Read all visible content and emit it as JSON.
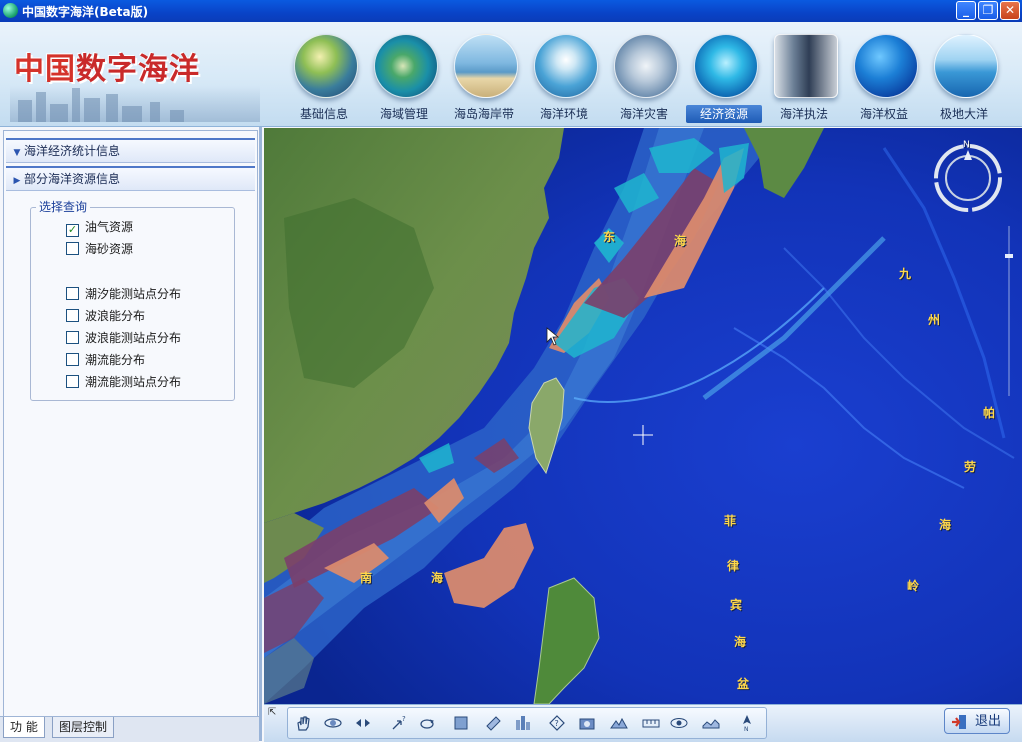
{
  "window": {
    "title": "中国数字海洋(Beta版)",
    "controls": {
      "minimize": "_",
      "restore": "❐",
      "close": "✕"
    }
  },
  "header": {
    "logo_part1": "中国",
    "logo_part2": "数字海洋",
    "nav_tabs": [
      {
        "label": "基础信息",
        "icon": "globe-asia-icon",
        "active": false
      },
      {
        "label": "海域管理",
        "icon": "island-aerial-icon",
        "active": false
      },
      {
        "label": "海岛海岸带",
        "icon": "beach-icon",
        "active": false
      },
      {
        "label": "海洋环境",
        "icon": "seabird-icon",
        "active": false
      },
      {
        "label": "海洋灾害",
        "icon": "storm-wave-icon",
        "active": false
      },
      {
        "label": "经济资源",
        "icon": "dolphins-icon",
        "active": true
      },
      {
        "label": "海洋执法",
        "icon": "officers-icon",
        "active": false
      },
      {
        "label": "海洋权益",
        "icon": "ocean-globe-icon",
        "active": false
      },
      {
        "label": "极地大洋",
        "icon": "polar-sea-icon",
        "active": false
      }
    ]
  },
  "left_panel": {
    "sections": [
      {
        "label": "海洋经济统计信息",
        "expanded": true
      },
      {
        "label": "部分海洋资源信息",
        "expanded": false
      }
    ],
    "query_group": {
      "label": "选择查询",
      "options": [
        {
          "label": "油气资源",
          "checked": true
        },
        {
          "label": "海砂资源",
          "checked": false
        },
        {
          "label": "潮汐能测站点分布",
          "checked": false
        },
        {
          "label": "波浪能分布",
          "checked": false
        },
        {
          "label": "波浪能测站点分布",
          "checked": false
        },
        {
          "label": "潮流能分布",
          "checked": false
        },
        {
          "label": "潮流能测站点分布",
          "checked": false
        }
      ]
    },
    "bottom_tabs": [
      {
        "label": "功 能",
        "active": true
      },
      {
        "label": "图层控制",
        "active": false
      }
    ]
  },
  "map": {
    "labels": {
      "east_sea_1": "东",
      "east_sea_2": "海",
      "south_sea_1": "南",
      "south_sea_2": "海",
      "kyushu": [
        "九",
        "州"
      ],
      "palau": [
        "帕",
        "劳",
        "海",
        "岭"
      ],
      "philippine": [
        "菲",
        "律",
        "宾",
        "海",
        "盆"
      ]
    },
    "compass_label": "N"
  },
  "toolbar": {
    "tools": [
      "pan-hand-icon",
      "orbit-icon",
      "rotate-arrows-icon",
      "zoom-query-icon",
      "rotate-view-icon",
      "layer-map-icon",
      "ruler-icon",
      "buildings-icon",
      "info-query-icon",
      "camera-icon",
      "terrain-icon",
      "scale-bar-icon",
      "view-eye-icon",
      "profile-icon",
      "north-arrow-icon"
    ],
    "exit_label": "退出"
  },
  "colors": {
    "accent": "#1e5bb5",
    "title_bar": "#0a4fd6",
    "oil_gas_zone_salmon": "#d98a6e",
    "oil_gas_zone_cyan": "#1fb5cf",
    "oil_gas_zone_plum": "#7b3f6a"
  }
}
